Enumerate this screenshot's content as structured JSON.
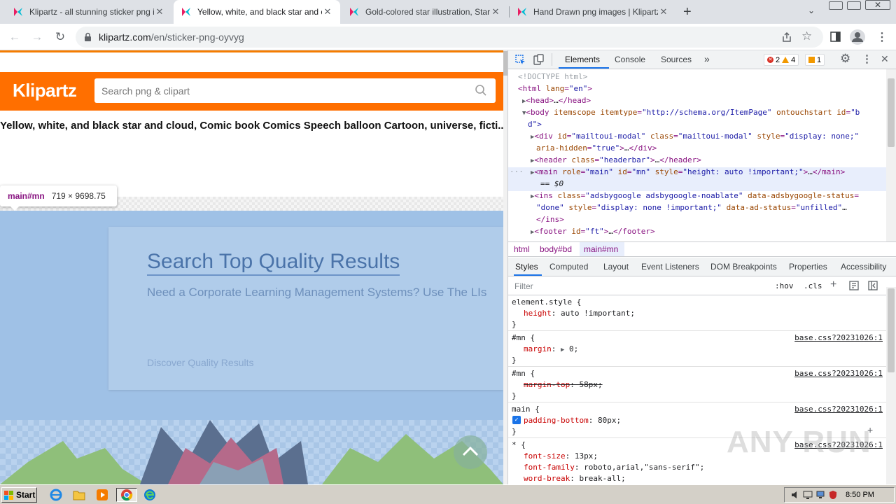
{
  "browser": {
    "tabs": [
      {
        "title": "Klipartz - all stunning sticker png ima",
        "active": false
      },
      {
        "title": "Yellow, white, and black star and clo",
        "active": true
      },
      {
        "title": "Gold-colored star illustration, Star De",
        "active": false
      },
      {
        "title": "Hand Drawn png images | Klipartz",
        "active": false
      }
    ],
    "url_host": "klipartz.com",
    "url_path": "/en/sticker-png-oyvyg"
  },
  "page": {
    "logo": "Klipartz",
    "search_placeholder": "Search png & clipart",
    "title": "Yellow, white, and black star and cloud, Comic book Comics Speech balloon Cartoon, universe, ficti...",
    "tooltip_tag": "main#mn",
    "tooltip_dims": "719 × 9698.75",
    "ad_title": "Search Top Quality Results",
    "ad_subtitle": "Need a Corporate Learning Management Systems? Use The LIs",
    "ad_link": "Discover Quality Results"
  },
  "devtools": {
    "tabs": [
      "Elements",
      "Console",
      "Sources"
    ],
    "more": "»",
    "errors": "2",
    "warnings": "4",
    "issues": "1",
    "breadcrumbs": [
      "html",
      "body#bd",
      "main#mn"
    ],
    "style_tabs": [
      "Styles",
      "Computed",
      "Layout",
      "Event Listeners",
      "DOM Breakpoints",
      "Properties",
      "Accessibility"
    ],
    "filter_placeholder": "Filter",
    "hov": ":hov",
    "cls": ".cls",
    "source": "base.css?20231026:1",
    "watermark": "ANY RUN"
  },
  "taskbar": {
    "start": "Start",
    "time": "8:50 PM"
  },
  "colors": {
    "brand_orange": "#ff6f00",
    "devtools_accent": "#1a73e8",
    "highlight": "#9fc1e6"
  }
}
